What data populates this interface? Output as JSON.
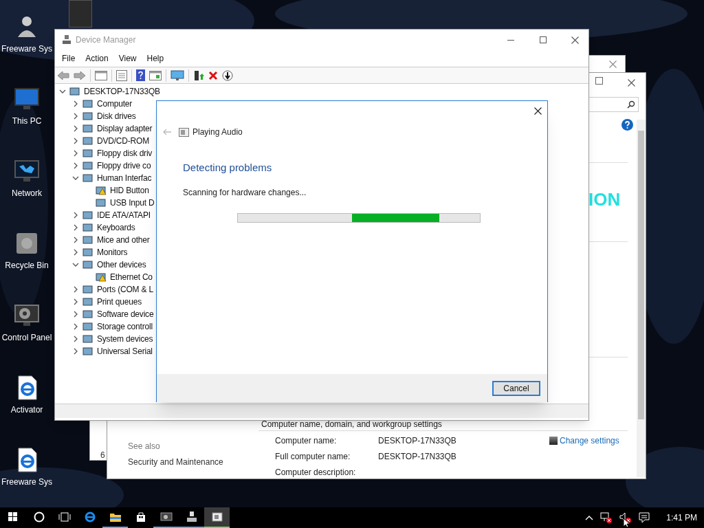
{
  "desktop_icons": [
    {
      "label": "Freeware Sys",
      "kind": "user"
    },
    {
      "label": "This PC",
      "kind": "pc"
    },
    {
      "label": "Network",
      "kind": "network"
    },
    {
      "label": "Recycle Bin",
      "kind": "recycle"
    },
    {
      "label": "Control Panel",
      "kind": "control"
    },
    {
      "label": "Activator",
      "kind": "edge"
    },
    {
      "label": "Freeware Sys",
      "kind": "edge"
    }
  ],
  "back_window": {
    "text": "6"
  },
  "system_window": {
    "logo_text": "ION",
    "section_title": "Computer name, domain, and workgroup settings",
    "see_also": "See also",
    "see_also_link": "Security and Maintenance",
    "fields": [
      {
        "label": "Computer name:",
        "value": "DESKTOP-17N33QB"
      },
      {
        "label": "Full computer name:",
        "value": "DESKTOP-17N33QB"
      },
      {
        "label": "Computer description:"
      }
    ],
    "change_settings": "Change settings"
  },
  "device_manager": {
    "title": "Device Manager",
    "menu": [
      "File",
      "Action",
      "View",
      "Help"
    ],
    "tree": {
      "label": "DESKTOP-17N33QB",
      "expanded": true,
      "children": [
        {
          "label": "Computer",
          "expanded": false
        },
        {
          "label": "Disk drives",
          "expanded": false
        },
        {
          "label": "Display adapter",
          "expanded": false
        },
        {
          "label": "DVD/CD-ROM",
          "expanded": false
        },
        {
          "label": "Floppy disk driv",
          "expanded": false
        },
        {
          "label": "Floppy drive co",
          "expanded": false
        },
        {
          "label": "Human Interfac",
          "expanded": true,
          "children": [
            {
              "label": "HID Button",
              "warning": true
            },
            {
              "label": "USB Input D",
              "warning": false
            }
          ]
        },
        {
          "label": "IDE ATA/ATAPI",
          "expanded": false
        },
        {
          "label": "Keyboards",
          "expanded": false
        },
        {
          "label": "Mice and other",
          "expanded": false
        },
        {
          "label": "Monitors",
          "expanded": false
        },
        {
          "label": "Other devices",
          "expanded": true,
          "children": [
            {
              "label": "Ethernet Co",
              "warning": true
            }
          ]
        },
        {
          "label": "Ports (COM & L",
          "expanded": false
        },
        {
          "label": "Print queues",
          "expanded": false
        },
        {
          "label": "Software device",
          "expanded": false
        },
        {
          "label": "Storage controll",
          "expanded": false
        },
        {
          "label": "System devices",
          "expanded": false
        },
        {
          "label": "Universal Serial",
          "expanded": false
        }
      ]
    }
  },
  "dialog": {
    "breadcrumb": "Playing Audio",
    "heading": "Detecting problems",
    "status": "Scanning for hardware changes...",
    "button": "Cancel"
  },
  "taskbar": {
    "items": [
      {
        "kind": "start",
        "open": false,
        "selected": false
      },
      {
        "kind": "cortana",
        "open": false,
        "selected": false
      },
      {
        "kind": "taskview",
        "open": false,
        "selected": false
      },
      {
        "kind": "edge",
        "open": false,
        "selected": false
      },
      {
        "kind": "explorer",
        "open": true,
        "selected": false
      },
      {
        "kind": "store",
        "open": false,
        "selected": false
      },
      {
        "kind": "app",
        "open": true,
        "selected": false
      },
      {
        "kind": "device",
        "open": true,
        "selected": false
      },
      {
        "kind": "troubleshoot",
        "open": true,
        "selected": true
      }
    ],
    "clock": "1:41 PM"
  }
}
